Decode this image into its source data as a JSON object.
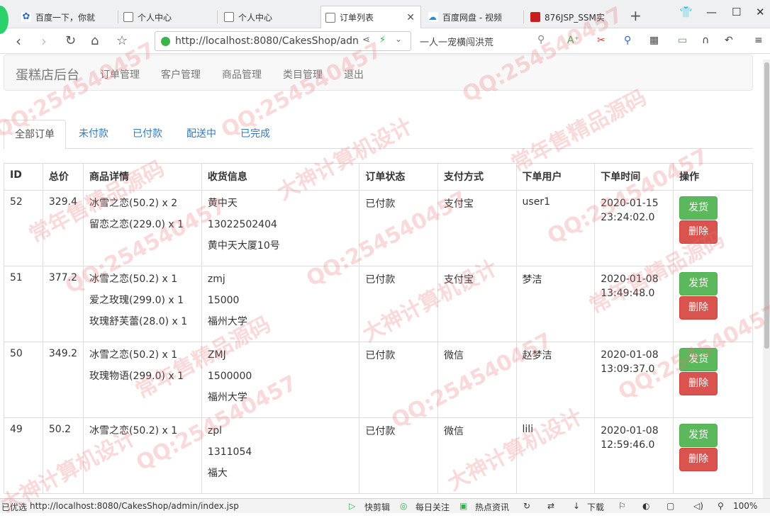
{
  "browser": {
    "tabs": [
      {
        "label": "百度一下，你就"
      },
      {
        "label": "个人中心"
      },
      {
        "label": "个人中心"
      },
      {
        "label": "订单列表",
        "active": true
      },
      {
        "label": "百度网盘 - 视频"
      },
      {
        "label": "876JSP_SSM实"
      }
    ],
    "url": "http://localhost:8080/CakesShop/adn",
    "search_text": "一人一宠横闯洪荒",
    "zoom": "100%"
  },
  "navbar": {
    "brand": "蛋糕店后台",
    "menu": [
      "订单管理",
      "客户管理",
      "商品管理",
      "类目管理",
      "退出"
    ]
  },
  "order_tabs": [
    "全部订单",
    "未付款",
    "已付款",
    "配送中",
    "已完成"
  ],
  "table": {
    "headers": [
      "ID",
      "总价",
      "商品详情",
      "收货信息",
      "订单状态",
      "支付方式",
      "下单用户",
      "下单时间",
      "操作"
    ],
    "ship_label": "发货",
    "delete_label": "删除",
    "rows": [
      {
        "id": "52",
        "total": "329.4",
        "items": [
          "冰雪之恋(50.2) x 2",
          "留恋之恋(229.0) x 1"
        ],
        "receiver": [
          "黄中天",
          "13022502404",
          "黄中天大厦10号"
        ],
        "status": "已付款",
        "payment": "支付宝",
        "user": "user1",
        "time": [
          "2020-01-15",
          "23:24:02.0"
        ]
      },
      {
        "id": "51",
        "total": "377.2",
        "items": [
          "冰雪之恋(50.2) x 1",
          "爱之玫瑰(299.0) x 1",
          "玫瑰舒芙蕾(28.0) x 1"
        ],
        "receiver": [
          "zmj",
          "15000",
          "福州大学"
        ],
        "status": "已付款",
        "payment": "支付宝",
        "user": "梦洁",
        "time": [
          "2020-01-08",
          "13:49:48.0"
        ]
      },
      {
        "id": "50",
        "total": "349.2",
        "items": [
          "冰雪之恋(50.2) x 1",
          "玫瑰物语(299.0) x 1"
        ],
        "receiver": [
          "ZMJ",
          "1500000",
          "福州大学"
        ],
        "status": "已付款",
        "payment": "微信",
        "user": "赵梦洁",
        "time": [
          "2020-01-08",
          "13:09:37.0"
        ]
      },
      {
        "id": "49",
        "total": "50.2",
        "items": [
          "冰雪之恋(50.2) x 1"
        ],
        "receiver": [
          "zpl",
          "1311054",
          "福大"
        ],
        "status": "已付款",
        "payment": "微信",
        "user": "lili",
        "time": [
          "2020-01-08",
          "12:59:46.0"
        ]
      }
    ]
  },
  "statusbar": {
    "left": "已优选",
    "url": "http://localhost:8080/CakesShop/admin/index.jsp",
    "items": [
      "快剪辑",
      "每日关注",
      "热点资讯",
      "下载"
    ]
  },
  "watermark": {
    "qq": "QQ:254540457",
    "line1": "常年售精品源码",
    "line2": "大神计算机设计"
  }
}
